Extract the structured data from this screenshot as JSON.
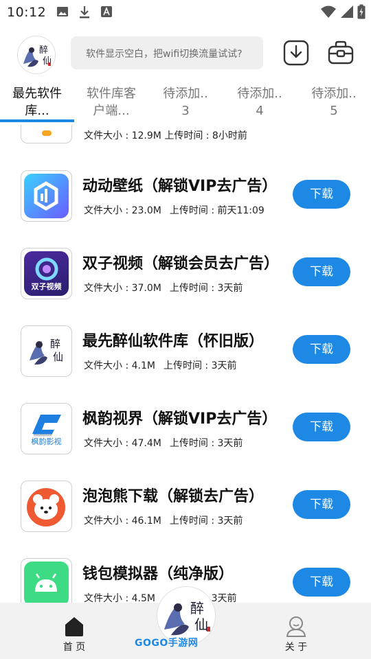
{
  "status_bar": {
    "time": "10:12"
  },
  "header": {
    "search_placeholder": "软件显示空白，把wifi切换流量试试?"
  },
  "tabs": [
    {
      "label_line1": "最先软件",
      "label_line2": "库..."
    },
    {
      "label_line1": "软件库客",
      "label_line2": "户端..."
    },
    {
      "label_line1": "待添加..",
      "label_line2": "3"
    },
    {
      "label_line1": "待添加..",
      "label_line2": "4"
    },
    {
      "label_line1": "待添加..",
      "label_line2": "5"
    }
  ],
  "list": {
    "partial_top": {
      "meta": "文件大小 : 12.9M   上传时间 : 8小时前"
    },
    "items": [
      {
        "title": "动动壁纸（解锁VIP去广告）",
        "size": "文件大小 : 23.0M",
        "time": "上传时间 : 前天11:09",
        "button": "下载"
      },
      {
        "title": "双子视频（解锁会员去广告）",
        "size": "文件大小 : 37.0M",
        "time": "上传时间 : 3天前",
        "button": "下载",
        "icon_text": "双子视频"
      },
      {
        "title": "最先醉仙软件库（怀旧版）",
        "size": "文件大小 : 4.1M",
        "time": "上传时间 : 3天前",
        "button": "下载"
      },
      {
        "title": "枫韵视界（解锁VIP去广告）",
        "size": "文件大小 : 47.4M",
        "time": "上传时间 : 3天前",
        "button": "下载",
        "icon_text": "枫韵影视"
      },
      {
        "title": "泡泡熊下载（解锁去广告）",
        "size": "文件大小 : 46.1M",
        "time": "上传时间 : 3天前",
        "button": "下载"
      },
      {
        "title": "钱包模拟器（纯净版）",
        "size": "文件大小 : 4.5M",
        "time": "上传时间 : 3天前",
        "button": "下载"
      }
    ]
  },
  "bottom_nav": {
    "home_label": "首 页",
    "about_label": "关 于",
    "watermark": "GOGO手游网"
  },
  "colors": {
    "accent": "#1e88e5",
    "search_bg": "#efefef",
    "nav_bg": "#f2f2f2"
  },
  "icons": {
    "status": [
      "image-icon",
      "download-icon",
      "font-icon",
      "wifi-icon",
      "signal-icon",
      "battery-icon"
    ],
    "header": [
      "download-box-icon",
      "toolbox-icon"
    ],
    "nav": [
      "home-icon",
      "user-icon"
    ]
  }
}
